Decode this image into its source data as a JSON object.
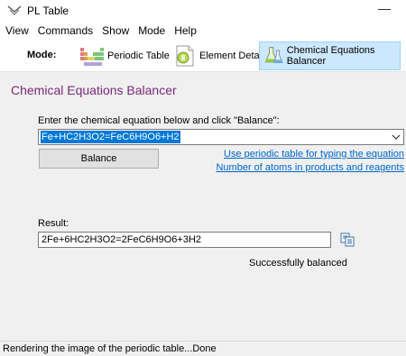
{
  "window": {
    "title": "PL Table",
    "minimize_glyph": "—"
  },
  "menu": [
    "View",
    "Commands",
    "Show",
    "Mode",
    "Help"
  ],
  "modebar": {
    "label": "Mode:",
    "modes": [
      {
        "label": "Periodic Table",
        "icon": "periodic-table-icon"
      },
      {
        "label": "Element Details",
        "icon": "element-details-icon"
      },
      {
        "label": "Chemical Equations Balancer",
        "icon": "flask-icon",
        "active": true
      }
    ]
  },
  "balancer": {
    "title": "Chemical Equations Balancer",
    "instruction": "Enter the chemical equation below and click \"Balance\":",
    "equation": "Fe+HC2H3O2=FeC6H9O6+H2",
    "balance_label": "Balance",
    "link_periodic": "Use periodic table for typing the equation",
    "link_atoms": "Number of atoms in products and reagents",
    "result_label": "Result:",
    "result_value": "2Fe+6HC2H3O2=2FeC6H9O6+3H2",
    "status": "Successfully balanced"
  },
  "statusbar": {
    "text": "Rendering the image of the periodic table...Done"
  },
  "colors": {
    "title_purple": "#7a2a7a",
    "link_blue": "#0066cc",
    "selection_blue": "#0078d7",
    "active_mode_bg": "#cce8ff"
  }
}
